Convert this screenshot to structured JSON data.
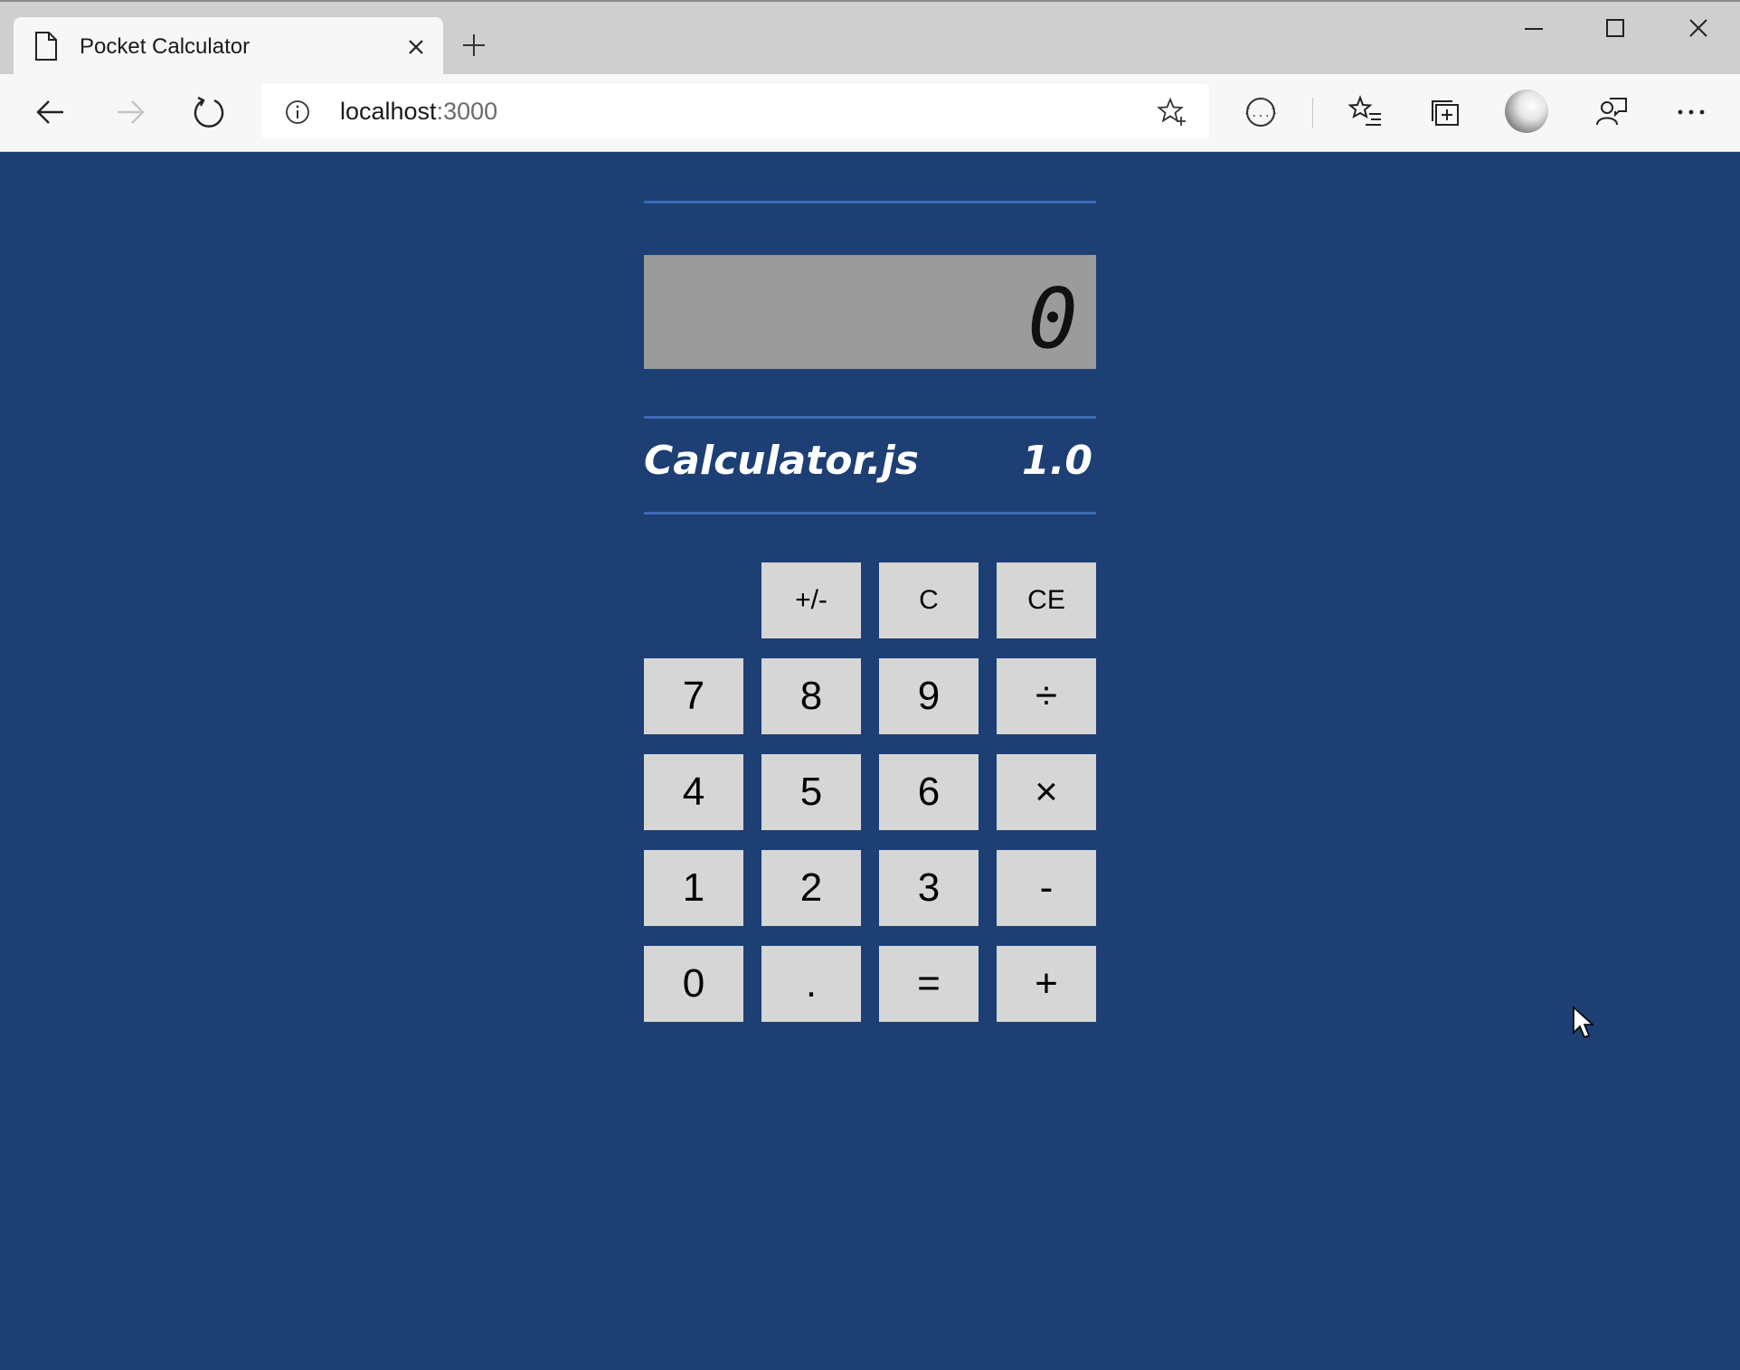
{
  "browser": {
    "tab": {
      "title": "Pocket Calculator",
      "icon": "page-icon"
    },
    "address": {
      "host": "localhost",
      "port": ":3000"
    }
  },
  "calculator": {
    "display_value": "0",
    "brand": {
      "name": "Calculator.js",
      "version": "1.0"
    },
    "keys": {
      "sign": "+/-",
      "clear": "C",
      "clear_entry": "CE",
      "seven": "7",
      "eight": "8",
      "nine": "9",
      "divide": "÷",
      "four": "4",
      "five": "5",
      "six": "6",
      "multiply": "×",
      "one": "1",
      "two": "2",
      "three": "3",
      "subtract": "-",
      "zero": "0",
      "decimal": ".",
      "equals": "=",
      "add": "+"
    }
  },
  "colors": {
    "page_background": "#1d3f74",
    "rule": "#3d6ab3",
    "display": "#9b9b9b",
    "key": "#d6d6d6"
  }
}
